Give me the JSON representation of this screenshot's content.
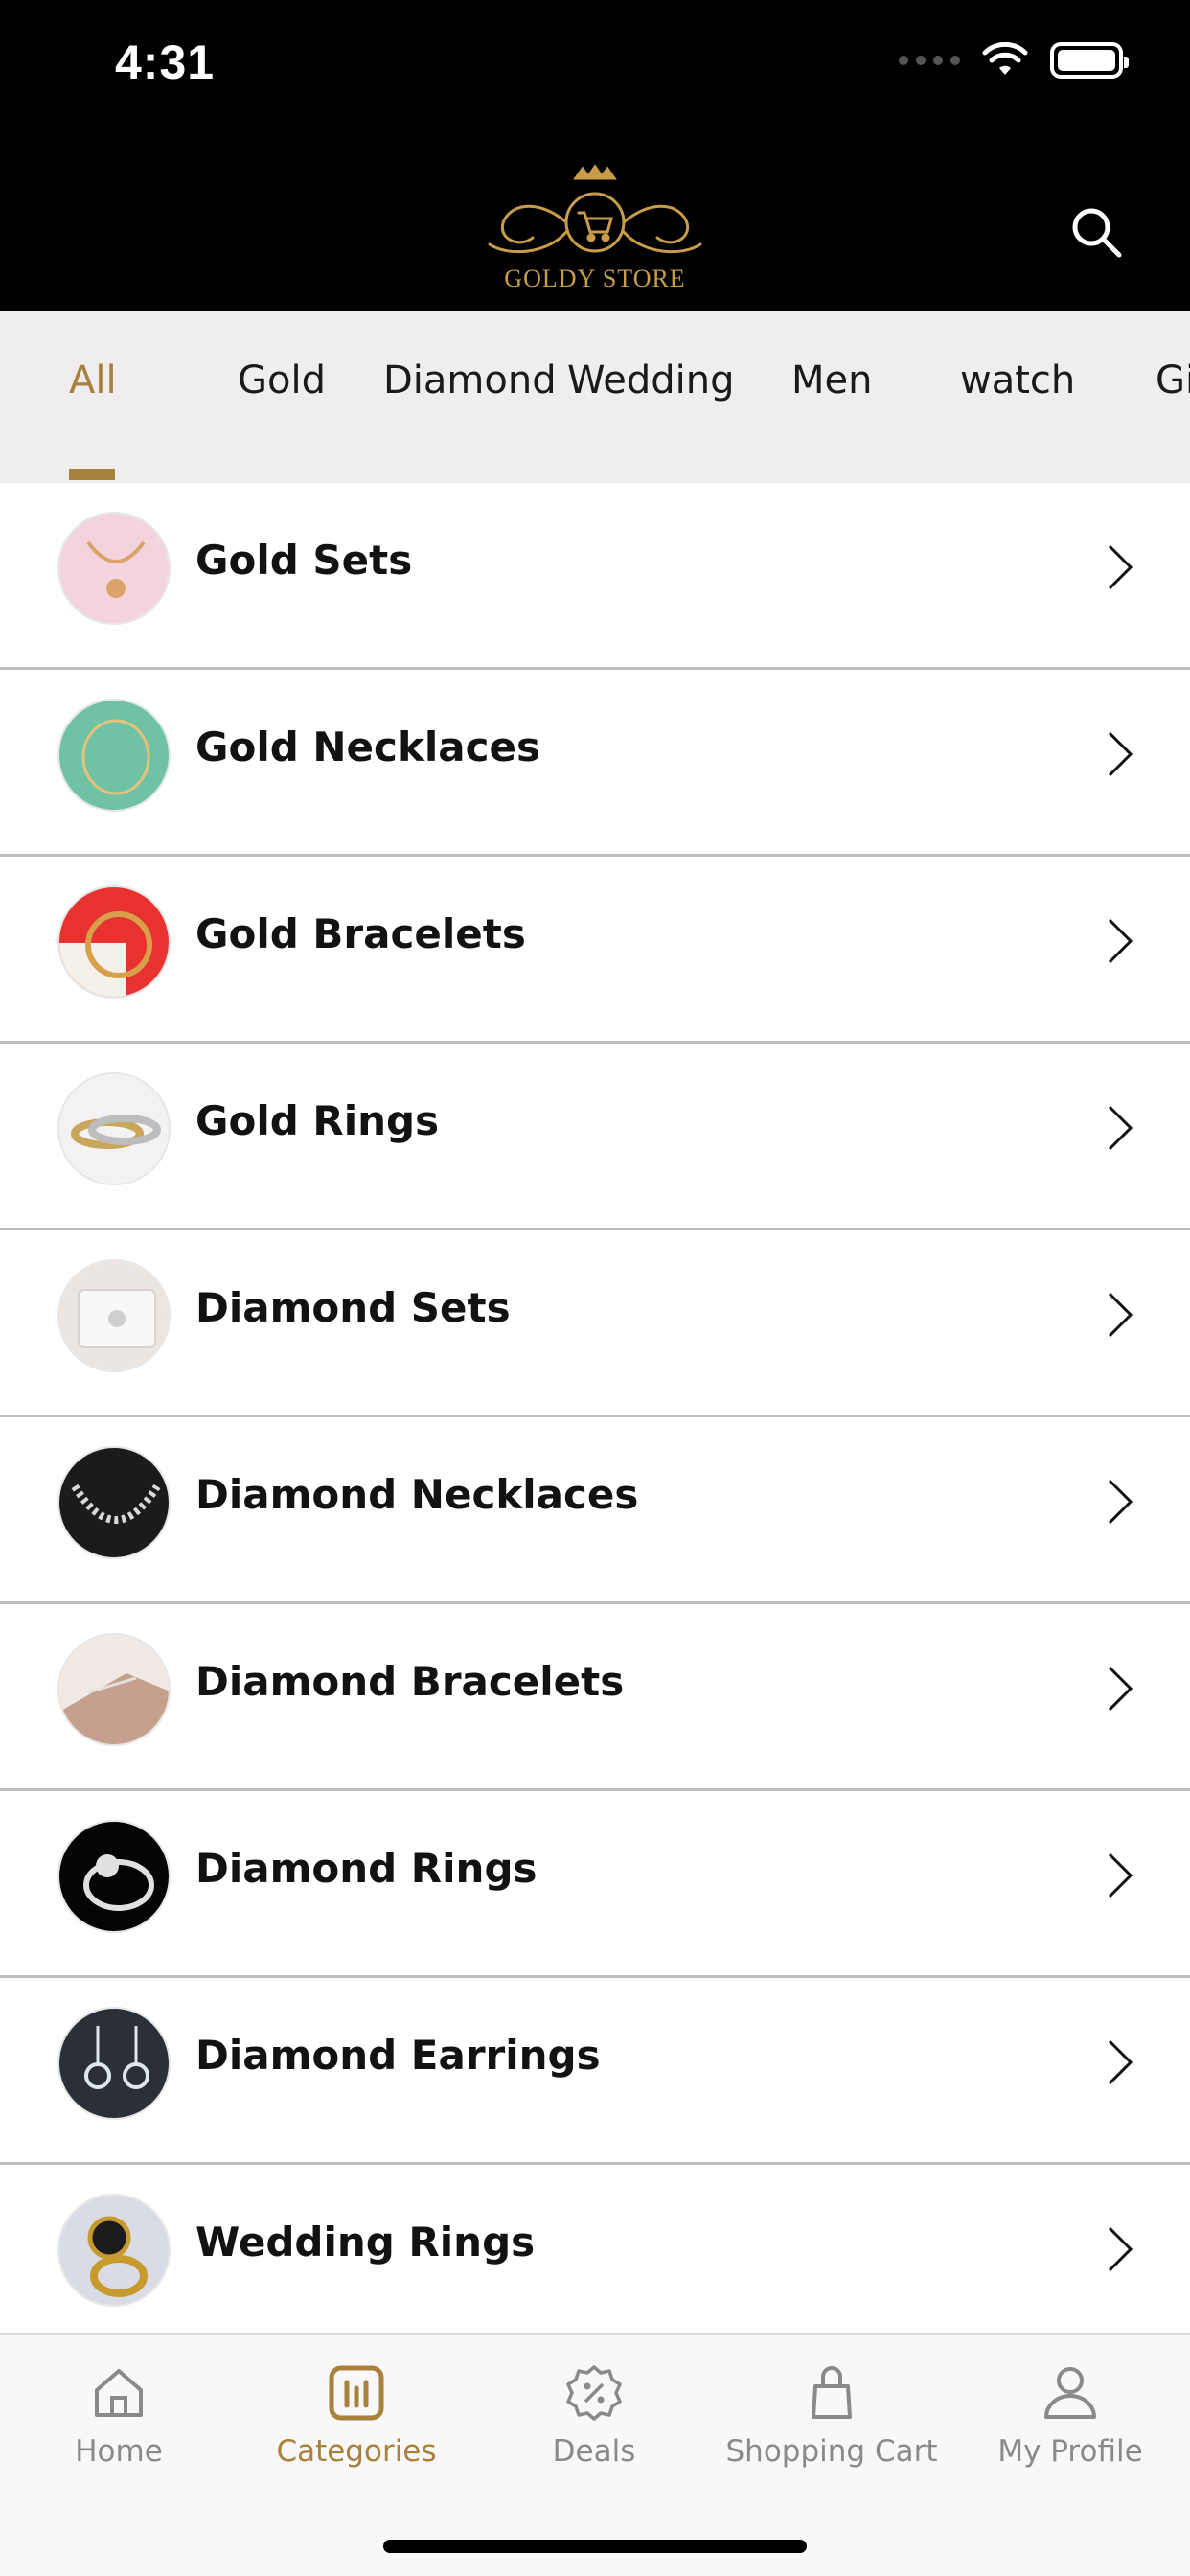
{
  "status_bar": {
    "time": "4:31"
  },
  "header": {
    "brand": "GOLDY STORE"
  },
  "tabs": [
    {
      "label": "All",
      "active": true
    },
    {
      "label": "Gold"
    },
    {
      "label": "Diamond"
    },
    {
      "label": "Wedding"
    },
    {
      "label": "Men"
    },
    {
      "label": "watch"
    },
    {
      "label": "Gi"
    }
  ],
  "categories": [
    {
      "label": "Gold Sets",
      "thumb_color": "#f3d3dc",
      "thumb_accent": "#d9a36b"
    },
    {
      "label": "Gold Necklaces",
      "thumb_color": "#6fc2a6",
      "thumb_accent": "#e6c27a"
    },
    {
      "label": "Gold Bracelets",
      "thumb_color": "#e8322f",
      "thumb_accent": "#d8a04a"
    },
    {
      "label": "Gold Rings",
      "thumb_color": "#f2f2f2",
      "thumb_accent": "#c9a659"
    },
    {
      "label": "Diamond Sets",
      "thumb_color": "#ece6e2",
      "thumb_accent": "#cfcfcf"
    },
    {
      "label": "Diamond Necklaces",
      "thumb_color": "#1b1b1b",
      "thumb_accent": "#d8d8d8"
    },
    {
      "label": "Diamond Bracelets",
      "thumb_color": "#f1e9e3",
      "thumb_accent": "#c4a08d"
    },
    {
      "label": "Diamond Rings",
      "thumb_color": "#050505",
      "thumb_accent": "#e0e0e0"
    },
    {
      "label": "Diamond Earrings",
      "thumb_color": "#2b2f36",
      "thumb_accent": "#dfe6ee"
    },
    {
      "label": "Wedding Rings",
      "thumb_color": "#d9dce4",
      "thumb_accent": "#c89a2e"
    }
  ],
  "bottom_nav": [
    {
      "label": "Home",
      "icon": "home-icon"
    },
    {
      "label": "Categories",
      "icon": "categories-icon",
      "active": true
    },
    {
      "label": "Deals",
      "icon": "deals-icon"
    },
    {
      "label": "Shopping Cart",
      "icon": "shopping-bag-icon"
    },
    {
      "label": "My Profile",
      "icon": "profile-icon"
    }
  ],
  "colors": {
    "accent": "#a8813c",
    "header_bg": "#000000",
    "tabs_bg": "#efedee",
    "nav_inactive": "#8a8a8a"
  }
}
